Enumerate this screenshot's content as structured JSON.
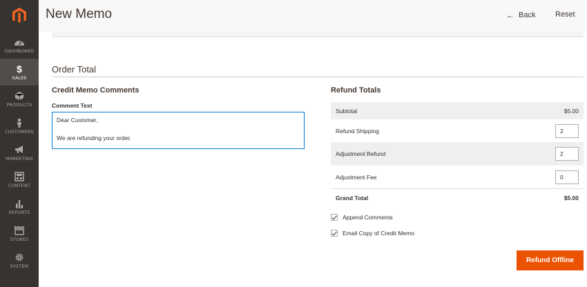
{
  "sidebar": {
    "items": [
      {
        "label": "DASHBOARD",
        "icon": "dashboard-icon"
      },
      {
        "label": "SALES",
        "icon": "dollar-icon",
        "active": true
      },
      {
        "label": "PRODUCTS",
        "icon": "cube-icon"
      },
      {
        "label": "CUSTOMERS",
        "icon": "person-icon"
      },
      {
        "label": "MARKETING",
        "icon": "megaphone-icon"
      },
      {
        "label": "CONTENT",
        "icon": "layout-icon"
      },
      {
        "label": "REPORTS",
        "icon": "bar-chart-icon"
      },
      {
        "label": "STORES",
        "icon": "storefront-icon"
      },
      {
        "label": "SYSTEM",
        "icon": "gear-icon"
      }
    ]
  },
  "header": {
    "title": "New Memo",
    "back_label": "Back",
    "reset_label": "Reset"
  },
  "order_total": {
    "section_title": "Order Total",
    "comments": {
      "title": "Credit Memo Comments",
      "label": "Comment Text",
      "value": "Dear Customer,\n\nWe are refunding your order."
    },
    "refund_totals": {
      "title": "Refund Totals",
      "subtotal_label": "Subtotal",
      "subtotal_value": "$5.00",
      "refund_shipping_label": "Refund Shipping",
      "refund_shipping_value": "2",
      "adjustment_refund_label": "Adjustment Refund",
      "adjustment_refund_value": "2",
      "adjustment_fee_label": "Adjustment Fee",
      "adjustment_fee_value": "0",
      "grand_total_label": "Grand Total",
      "grand_total_value": "$5.00"
    },
    "options": {
      "append_comments": "Append Comments",
      "email_copy": "Email Copy of Credit Memo"
    },
    "refund_button": "Refund Offline"
  },
  "colors": {
    "accent": "#eb5202",
    "sidebar_bg": "#373330",
    "focus_border": "#007bdb"
  }
}
